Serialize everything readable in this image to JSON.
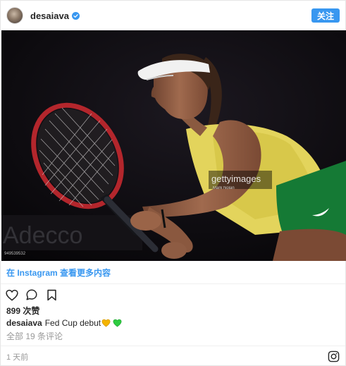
{
  "post": {
    "username": "desaiava",
    "follow_label": "关注",
    "view_on_instagram": "在 Instagram 查看更多内容",
    "likes": "899 次赞",
    "caption_user": "desaiava",
    "caption_text": "Fed Cup debut",
    "comments_link": "全部 19 条评论",
    "time_ago": "1 天前"
  },
  "photo": {
    "watermark": "gettyimages",
    "credit": "Mark Nolan",
    "image_id": "949539532",
    "background_sign": "Adecco"
  },
  "colors": {
    "accent": "#3897f0",
    "heart_yellow": "#f4b400",
    "heart_green": "#2ecc40"
  }
}
